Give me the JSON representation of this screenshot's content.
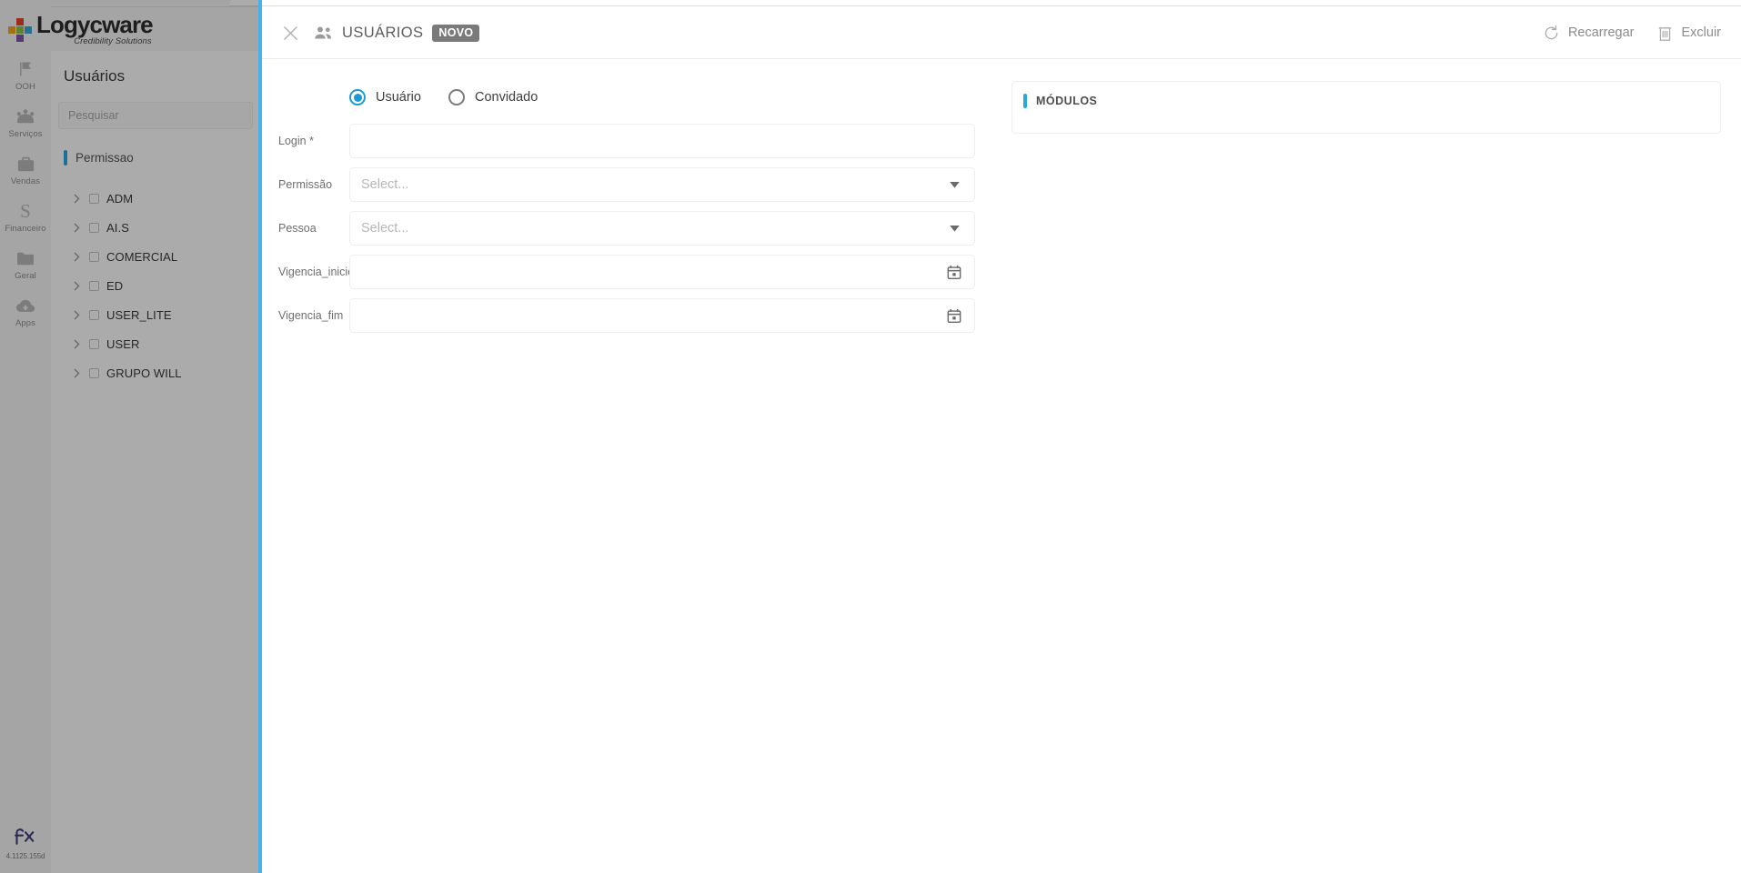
{
  "brand": {
    "name": "Logycware",
    "tagline": "Credibility Solutions",
    "plus_icon": "plus-logo-icon"
  },
  "icon_rail": {
    "items": [
      {
        "label": "OOH",
        "icon": "flag-icon"
      },
      {
        "label": "Serviços",
        "icon": "crown-icon"
      },
      {
        "label": "Vendas",
        "icon": "briefcase-icon"
      },
      {
        "label": "Financeiro",
        "icon": "dollar-s-icon"
      },
      {
        "label": "Geral",
        "icon": "folder-icon"
      },
      {
        "label": "Apps",
        "icon": "cloud-plus-icon"
      }
    ],
    "footer": {
      "logo": "fx-infinity-icon",
      "version": "4.1125.155d"
    }
  },
  "list_panel": {
    "title": "Usuários",
    "search": {
      "placeholder": "Pesquisar",
      "value": ""
    },
    "permission_section": {
      "label": "Permissao",
      "accent_color": "#29a8e0",
      "items": [
        {
          "label": "ADM",
          "checked": false,
          "expanded": false
        },
        {
          "label": "AI.S",
          "checked": false,
          "expanded": false
        },
        {
          "label": "COMERCIAL",
          "checked": false,
          "expanded": false
        },
        {
          "label": "ED",
          "checked": false,
          "expanded": false
        },
        {
          "label": "USER_LITE",
          "checked": false,
          "expanded": false
        },
        {
          "label": "USER",
          "checked": false,
          "expanded": false
        },
        {
          "label": "GRUPO WILL",
          "checked": false,
          "expanded": false
        }
      ]
    }
  },
  "modal": {
    "close_icon": "close-icon",
    "title_icon": "users-icon",
    "title": "USUÁRIOS",
    "badge": "NOVO",
    "badge_color": "#7a7a7a",
    "actions": [
      {
        "label": "Recarregar",
        "icon": "reload-icon"
      },
      {
        "label": "Excluir",
        "icon": "trash-icon"
      }
    ],
    "type_radio": {
      "selected": "Usuário",
      "accent_color": "#1c9ad6",
      "options": [
        {
          "label": "Usuário",
          "selected": true
        },
        {
          "label": "Convidado",
          "selected": false
        }
      ]
    },
    "fields": [
      {
        "name": "login",
        "label": "Login *",
        "kind": "text",
        "value": "",
        "placeholder": "",
        "adorn": ""
      },
      {
        "name": "permissao",
        "label": "Permissão",
        "kind": "select",
        "value": "",
        "placeholder": "Select...",
        "adorn": "chevron-down-icon"
      },
      {
        "name": "pessoa",
        "label": "Pessoa",
        "kind": "select",
        "value": "",
        "placeholder": "Select...",
        "adorn": "chevron-down-icon"
      },
      {
        "name": "vigencia_inicio",
        "label": "Vigencia_inicio",
        "kind": "date",
        "value": "",
        "placeholder": "",
        "adorn": "calendar-icon"
      },
      {
        "name": "vigencia_fim",
        "label": "Vigencia_fim",
        "kind": "date",
        "value": "",
        "placeholder": "",
        "adorn": "calendar-icon"
      }
    ],
    "modules_panel": {
      "title": "MÓDULOS",
      "accent_color": "#29a8e0",
      "items": []
    }
  }
}
